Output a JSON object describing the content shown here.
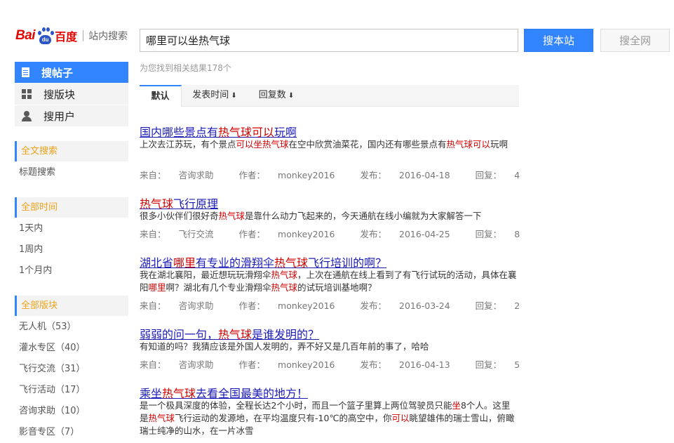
{
  "header": {
    "logo_bai": "Bai",
    "logo_du": "du",
    "logo_cn": "百度",
    "site_search": "站内搜索",
    "query": "哪里可以坐热气球",
    "btn_site": "搜本站",
    "btn_all": "搜全网"
  },
  "sidebar": {
    "nav": [
      {
        "label": "搜帖子",
        "icon": "post-icon"
      },
      {
        "label": "搜版块",
        "icon": "grid-icon"
      },
      {
        "label": "搜用户",
        "icon": "user-icon"
      }
    ],
    "fulltext": {
      "head": "全文搜索",
      "link": "标题搜索"
    },
    "time": {
      "head": "全部时间",
      "links": [
        "1天内",
        "1周内",
        "1个月内"
      ]
    },
    "board": {
      "head": "全部版块",
      "links": [
        "无人机（53）",
        "灌水专区（40）",
        "飞行交流（31）",
        "飞行活动（17）",
        "咨询求助（10）",
        "影音专区（7）"
      ]
    }
  },
  "results_count": "为您找到相关结果178个",
  "tabs": [
    {
      "label": "默认",
      "arrow": ""
    },
    {
      "label": "发表时间",
      "arrow": "⬇"
    },
    {
      "label": "回复数",
      "arrow": "⬇"
    }
  ],
  "meta_labels": {
    "source": "来自：",
    "author": "作者：",
    "date": "发布：",
    "replies": "回复："
  },
  "results": [
    {
      "title": [
        {
          "t": "国内哪些景点有"
        },
        {
          "t": "热气球可以",
          "h": true
        },
        {
          "t": "玩啊"
        }
      ],
      "desc": [
        {
          "t": "上次去江苏玩，有个景点"
        },
        {
          "t": "可以坐热气球",
          "h": true
        },
        {
          "t": "在空中欣赏油菜花，国内还有哪些景点有"
        },
        {
          "t": "热气球可以",
          "h": true
        },
        {
          "t": "玩啊"
        }
      ],
      "source": "咨询求助",
      "author": "monkey2016",
      "date": "2016-04-18",
      "replies": "4"
    },
    {
      "title": [
        {
          "t": "热气球",
          "h": true
        },
        {
          "t": "飞行原理"
        }
      ],
      "desc": [
        {
          "t": "很多小伙伴们很好奇"
        },
        {
          "t": "热气球",
          "h": true
        },
        {
          "t": "是靠什么动力飞起来的，今天通航在线小编就为大家解答一下"
        }
      ],
      "source": "飞行交流",
      "author": "monkey2016",
      "date": "2016-04-25",
      "replies": "8"
    },
    {
      "title": [
        {
          "t": "湖北省"
        },
        {
          "t": "哪里",
          "h": true
        },
        {
          "t": "有专业的滑翔伞"
        },
        {
          "t": "热气球",
          "h": true
        },
        {
          "t": "飞行培训的啊？"
        }
      ],
      "desc": [
        {
          "t": "我在湖北襄阳，最近想玩玩滑翔伞"
        },
        {
          "t": "热气球",
          "h": true
        },
        {
          "t": "，上次在通航在线上看到了有飞行试玩的活动，具体在襄阳"
        },
        {
          "t": "哪里",
          "h": true
        },
        {
          "t": "啊？湖北有几个专业滑翔伞"
        },
        {
          "t": "热气球",
          "h": true
        },
        {
          "t": "的试玩培训基地啊？"
        }
      ],
      "source": "咨询求助",
      "author": "monkey2016",
      "date": "2016-03-24",
      "replies": "2"
    },
    {
      "title": [
        {
          "t": "弱弱的问一句，"
        },
        {
          "t": "热气球",
          "h": true
        },
        {
          "t": "是谁发明的？"
        }
      ],
      "desc": [
        {
          "t": "有知道的吗？我猜应该是外国人发明的，弄不好又是几百年前的事了，哈哈"
        }
      ],
      "source": "咨询求助",
      "author": "monkey2016",
      "date": "2016-04-13",
      "replies": "5"
    },
    {
      "title": [
        {
          "t": "乘坐"
        },
        {
          "t": "热气球",
          "h": true
        },
        {
          "t": "去看全国最美的地方！"
        }
      ],
      "desc": [
        {
          "t": "是一个极具深度的体验，全程长达2个小时，而且一个篮子里算上两位驾驶员只能"
        },
        {
          "t": "坐",
          "h": true
        },
        {
          "t": "8个人。这里是"
        },
        {
          "t": "热气球",
          "h": true
        },
        {
          "t": "飞行运动的发源地，在平均温度只有-10℃的高空中，你"
        },
        {
          "t": "可以",
          "h": true
        },
        {
          "t": "眺望雄伟的瑞士雪山，俯瞰瑞士纯净的山水，在一片冰雪"
        }
      ]
    }
  ],
  "colors": {
    "accent": "#3385ff",
    "highlight": "#d30000",
    "link": "#1c1cb8",
    "section_head": "#f0a21b"
  }
}
